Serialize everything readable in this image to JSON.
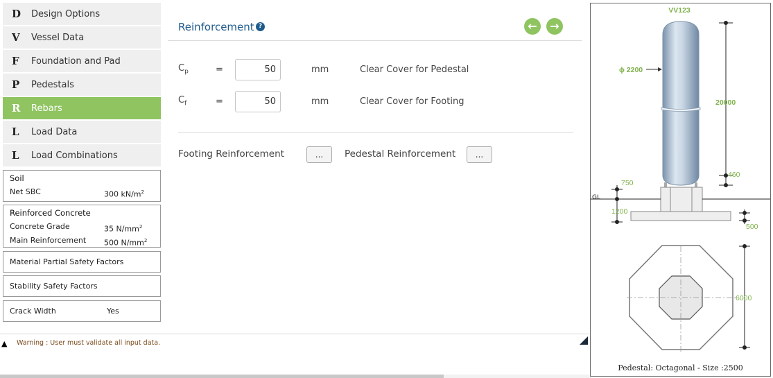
{
  "nav": [
    {
      "letter": "D",
      "label": "Design Options",
      "active": false
    },
    {
      "letter": "V",
      "label": "Vessel Data",
      "active": false
    },
    {
      "letter": "F",
      "label": "Foundation and Pad",
      "active": false
    },
    {
      "letter": "P",
      "label": "Pedestals",
      "active": false
    },
    {
      "letter": "R",
      "label": "Rebars",
      "active": true
    },
    {
      "letter": "L",
      "label": "Load Data",
      "active": false
    },
    {
      "letter": "L",
      "label": "Load Combinations",
      "active": false
    }
  ],
  "soil": {
    "title": "Soil",
    "net_sbc_label": "Net SBC",
    "net_sbc_value": "300 kN/m",
    "net_sbc_sup": "2"
  },
  "concrete": {
    "title": "Reinforced Concrete",
    "grade_label": "Concrete Grade",
    "grade_value": "35 N/mm",
    "grade_sup": "2",
    "main_label": "Main Reinforcement",
    "main_value": "500 N/mm",
    "main_sup": "2"
  },
  "material_factors": {
    "title": "Material Partial Safety Factors"
  },
  "stability_factors": {
    "title": "Stability Safety Factors"
  },
  "crack": {
    "label": "Crack Width",
    "value": "Yes"
  },
  "warning": {
    "text": "Warning : User must validate all input data."
  },
  "main": {
    "title": "Reinforcement",
    "help_icon": "question-circle-icon",
    "prev_icon": "arrow-left-circle-icon",
    "next_icon": "arrow-right-circle-icon",
    "params": [
      {
        "sym": "C",
        "sub": "p",
        "eq": "=",
        "value": "50",
        "unit": "mm",
        "desc": "Clear Cover for Pedestal"
      },
      {
        "sym": "C",
        "sub": "f",
        "eq": "=",
        "value": "50",
        "unit": "mm",
        "desc": "Clear Cover for Footing"
      }
    ],
    "footing_label": "Footing Reinforcement",
    "pedestal_label": "Pedestal Reinforcement",
    "button_text": "..."
  },
  "drawing": {
    "vessel_id": "VV123",
    "diameter": "ϕ 2200",
    "height": "20000",
    "h460": "460",
    "h750": "750",
    "gl": "GL",
    "h1200": "1200",
    "h500": "500",
    "plan_size": "6000",
    "caption": "Pedestal: Octagonal - Size :2500"
  },
  "colors": {
    "accent_green": "#8fc461",
    "title_blue": "#1f5a8c",
    "dim_green": "#7fb24a"
  }
}
